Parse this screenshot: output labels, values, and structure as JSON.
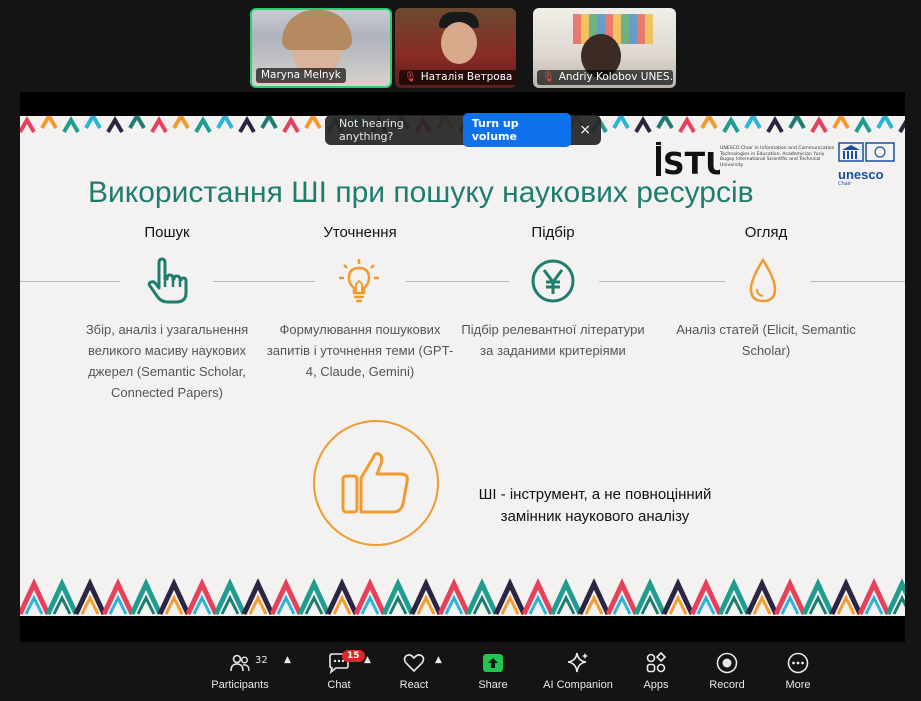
{
  "participants": [
    {
      "name": "Maryna Melnyk",
      "muted": false,
      "active_speaker": true
    },
    {
      "name": "Наталія Ветрова",
      "muted": true,
      "active_speaker": false
    },
    {
      "name": "Andriy Kolobov UNES...",
      "muted": true,
      "active_speaker": false
    }
  ],
  "volume_banner": {
    "message": "Not hearing anything?",
    "button_label": "Turn up volume",
    "close": "×"
  },
  "slide": {
    "title": "Використання ШІ при пошуку наукових ресурсів",
    "logos": {
      "istu": "ISTU",
      "istu_caption": "UNESCO Chair in Information and Communication Technologies in Education. Academician Yuriy Bugay International Scientific and Technical University",
      "unesco": "unesco",
      "unesco_sub": "Chair"
    },
    "steps": [
      {
        "heading": "Пошук",
        "icon": "pointing-hand-icon",
        "description": "Збір, аналіз і узагальнення великого масиву наукових джерел (Semantic Scholar, Connected Papers)"
      },
      {
        "heading": "Уточнення",
        "icon": "lightbulb-icon",
        "description": "Формулювання пошукових запитів і уточнення теми (GPT-4, Claude, Gemini)"
      },
      {
        "heading": "Підбір",
        "icon": "yen-coin-icon",
        "description": "Підбір релевантної літератури за заданими критеріями"
      },
      {
        "heading": "Огляд",
        "icon": "drop-icon",
        "description": "Аналіз статей (Elicit, Semantic Scholar)"
      }
    ],
    "conclusion_line1": "ШІ - інструмент, а не повноцінний",
    "conclusion_line2": "замінник наукового аналізу",
    "colors": {
      "title": "#1f7d6f",
      "teal_icon": "#1f7d6f",
      "orange_icon": "#f29a2e"
    }
  },
  "toolbar": {
    "participants_label": "Participants",
    "participants_count": "32",
    "chat_label": "Chat",
    "chat_badge": "15",
    "react_label": "React",
    "share_label": "Share",
    "ai_label": "AI Companion",
    "apps_label": "Apps",
    "record_label": "Record",
    "more_label": "More"
  }
}
